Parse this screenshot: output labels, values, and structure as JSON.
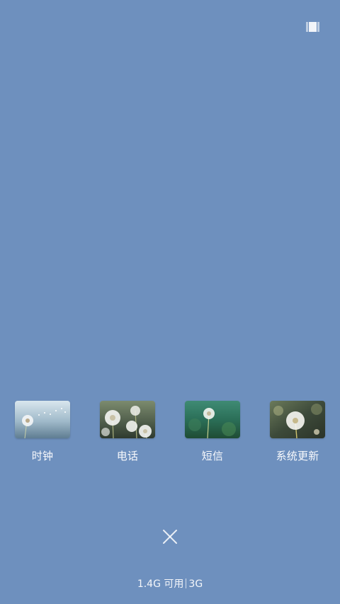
{
  "screen": {
    "background_color": "#6e90be"
  },
  "top_right": {
    "icon": "memory-layout-icon"
  },
  "recent_apps": [
    {
      "label": "时钟",
      "thumbnail": "dandelion-sky-thumbnail"
    },
    {
      "label": "电话",
      "thumbnail": "dandelion-cluster-thumbnail"
    },
    {
      "label": "短信",
      "thumbnail": "dandelion-green-thumbnail"
    },
    {
      "label": "系统更新",
      "thumbnail": "dandelion-bokeh-thumbnail"
    }
  ],
  "controls": {
    "clear_all_icon": "close-x-icon"
  },
  "status": {
    "memory_available": "1.4G 可用",
    "network": "3G"
  }
}
